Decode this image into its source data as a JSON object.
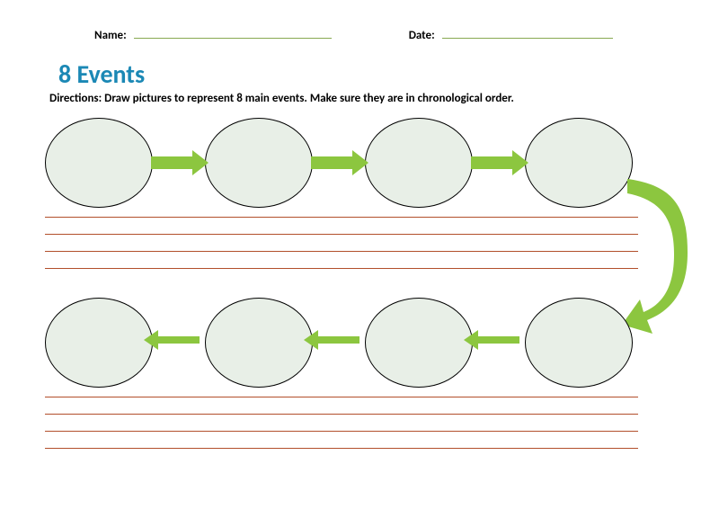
{
  "header": {
    "name_label": "Name:",
    "date_label": "Date:"
  },
  "title": "8 Events",
  "directions": "Directions: Draw pictures to represent 8 main events. Make sure they are in chronological order.",
  "colors": {
    "title": "#1b88b5",
    "arrow": "#8cc63f",
    "circle_fill": "#e8efe7",
    "rule_line": "#b24f2b",
    "header_line": "#87a950"
  },
  "event_count": 8,
  "chart_data": {
    "type": "diagram",
    "title": "8 Events",
    "nodes": [
      {
        "id": 1,
        "row": 1,
        "position": 1
      },
      {
        "id": 2,
        "row": 1,
        "position": 2
      },
      {
        "id": 3,
        "row": 1,
        "position": 3
      },
      {
        "id": 4,
        "row": 1,
        "position": 4
      },
      {
        "id": 5,
        "row": 2,
        "position": 4
      },
      {
        "id": 6,
        "row": 2,
        "position": 3
      },
      {
        "id": 7,
        "row": 2,
        "position": 2
      },
      {
        "id": 8,
        "row": 2,
        "position": 1
      }
    ],
    "edges": [
      {
        "from": 1,
        "to": 2,
        "direction": "right"
      },
      {
        "from": 2,
        "to": 3,
        "direction": "right"
      },
      {
        "from": 3,
        "to": 4,
        "direction": "right"
      },
      {
        "from": 4,
        "to": 5,
        "direction": "curve-down"
      },
      {
        "from": 5,
        "to": 6,
        "direction": "left"
      },
      {
        "from": 6,
        "to": 7,
        "direction": "left"
      },
      {
        "from": 7,
        "to": 8,
        "direction": "left"
      }
    ],
    "writing_lines_per_row": 4
  }
}
